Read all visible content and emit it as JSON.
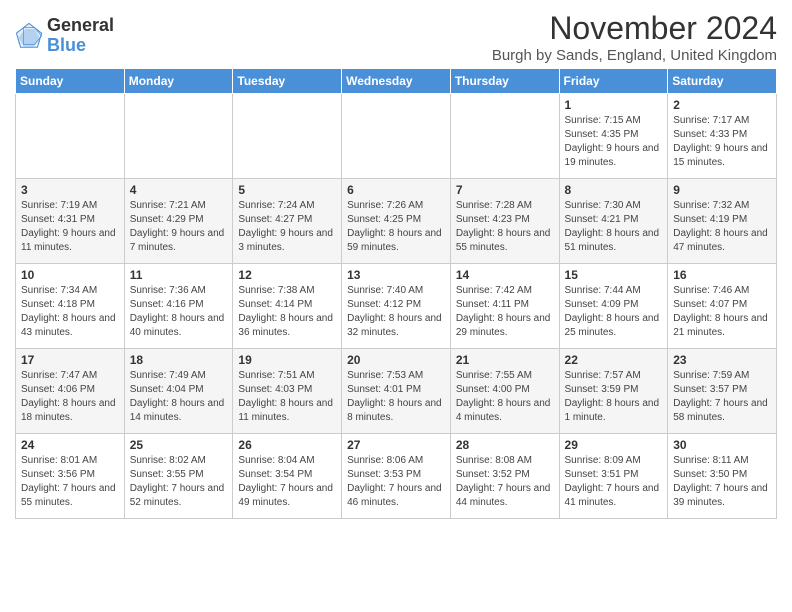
{
  "logo": {
    "general": "General",
    "blue": "Blue"
  },
  "title": "November 2024",
  "location": "Burgh by Sands, England, United Kingdom",
  "days_of_week": [
    "Sunday",
    "Monday",
    "Tuesday",
    "Wednesday",
    "Thursday",
    "Friday",
    "Saturday"
  ],
  "weeks": [
    [
      {
        "day": "",
        "info": ""
      },
      {
        "day": "",
        "info": ""
      },
      {
        "day": "",
        "info": ""
      },
      {
        "day": "",
        "info": ""
      },
      {
        "day": "",
        "info": ""
      },
      {
        "day": "1",
        "info": "Sunrise: 7:15 AM\nSunset: 4:35 PM\nDaylight: 9 hours and 19 minutes."
      },
      {
        "day": "2",
        "info": "Sunrise: 7:17 AM\nSunset: 4:33 PM\nDaylight: 9 hours and 15 minutes."
      }
    ],
    [
      {
        "day": "3",
        "info": "Sunrise: 7:19 AM\nSunset: 4:31 PM\nDaylight: 9 hours and 11 minutes."
      },
      {
        "day": "4",
        "info": "Sunrise: 7:21 AM\nSunset: 4:29 PM\nDaylight: 9 hours and 7 minutes."
      },
      {
        "day": "5",
        "info": "Sunrise: 7:24 AM\nSunset: 4:27 PM\nDaylight: 9 hours and 3 minutes."
      },
      {
        "day": "6",
        "info": "Sunrise: 7:26 AM\nSunset: 4:25 PM\nDaylight: 8 hours and 59 minutes."
      },
      {
        "day": "7",
        "info": "Sunrise: 7:28 AM\nSunset: 4:23 PM\nDaylight: 8 hours and 55 minutes."
      },
      {
        "day": "8",
        "info": "Sunrise: 7:30 AM\nSunset: 4:21 PM\nDaylight: 8 hours and 51 minutes."
      },
      {
        "day": "9",
        "info": "Sunrise: 7:32 AM\nSunset: 4:19 PM\nDaylight: 8 hours and 47 minutes."
      }
    ],
    [
      {
        "day": "10",
        "info": "Sunrise: 7:34 AM\nSunset: 4:18 PM\nDaylight: 8 hours and 43 minutes."
      },
      {
        "day": "11",
        "info": "Sunrise: 7:36 AM\nSunset: 4:16 PM\nDaylight: 8 hours and 40 minutes."
      },
      {
        "day": "12",
        "info": "Sunrise: 7:38 AM\nSunset: 4:14 PM\nDaylight: 8 hours and 36 minutes."
      },
      {
        "day": "13",
        "info": "Sunrise: 7:40 AM\nSunset: 4:12 PM\nDaylight: 8 hours and 32 minutes."
      },
      {
        "day": "14",
        "info": "Sunrise: 7:42 AM\nSunset: 4:11 PM\nDaylight: 8 hours and 29 minutes."
      },
      {
        "day": "15",
        "info": "Sunrise: 7:44 AM\nSunset: 4:09 PM\nDaylight: 8 hours and 25 minutes."
      },
      {
        "day": "16",
        "info": "Sunrise: 7:46 AM\nSunset: 4:07 PM\nDaylight: 8 hours and 21 minutes."
      }
    ],
    [
      {
        "day": "17",
        "info": "Sunrise: 7:47 AM\nSunset: 4:06 PM\nDaylight: 8 hours and 18 minutes."
      },
      {
        "day": "18",
        "info": "Sunrise: 7:49 AM\nSunset: 4:04 PM\nDaylight: 8 hours and 14 minutes."
      },
      {
        "day": "19",
        "info": "Sunrise: 7:51 AM\nSunset: 4:03 PM\nDaylight: 8 hours and 11 minutes."
      },
      {
        "day": "20",
        "info": "Sunrise: 7:53 AM\nSunset: 4:01 PM\nDaylight: 8 hours and 8 minutes."
      },
      {
        "day": "21",
        "info": "Sunrise: 7:55 AM\nSunset: 4:00 PM\nDaylight: 8 hours and 4 minutes."
      },
      {
        "day": "22",
        "info": "Sunrise: 7:57 AM\nSunset: 3:59 PM\nDaylight: 8 hours and 1 minute."
      },
      {
        "day": "23",
        "info": "Sunrise: 7:59 AM\nSunset: 3:57 PM\nDaylight: 7 hours and 58 minutes."
      }
    ],
    [
      {
        "day": "24",
        "info": "Sunrise: 8:01 AM\nSunset: 3:56 PM\nDaylight: 7 hours and 55 minutes."
      },
      {
        "day": "25",
        "info": "Sunrise: 8:02 AM\nSunset: 3:55 PM\nDaylight: 7 hours and 52 minutes."
      },
      {
        "day": "26",
        "info": "Sunrise: 8:04 AM\nSunset: 3:54 PM\nDaylight: 7 hours and 49 minutes."
      },
      {
        "day": "27",
        "info": "Sunrise: 8:06 AM\nSunset: 3:53 PM\nDaylight: 7 hours and 46 minutes."
      },
      {
        "day": "28",
        "info": "Sunrise: 8:08 AM\nSunset: 3:52 PM\nDaylight: 7 hours and 44 minutes."
      },
      {
        "day": "29",
        "info": "Sunrise: 8:09 AM\nSunset: 3:51 PM\nDaylight: 7 hours and 41 minutes."
      },
      {
        "day": "30",
        "info": "Sunrise: 8:11 AM\nSunset: 3:50 PM\nDaylight: 7 hours and 39 minutes."
      }
    ]
  ]
}
